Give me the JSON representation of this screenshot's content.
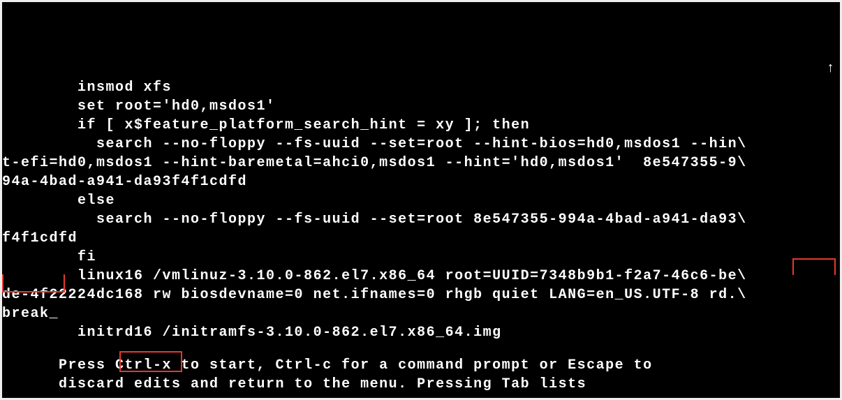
{
  "grub": {
    "lines": [
      "        insmod xfs",
      "        set root='hd0,msdos1'",
      "        if [ x$feature_platform_search_hint = xy ]; then",
      "          search --no-floppy --fs-uuid --set=root --hint-bios=hd0,msdos1 --hin\\",
      "t-efi=hd0,msdos1 --hint-baremetal=ahci0,msdos1 --hint='hd0,msdos1'  8e547355-9\\",
      "94a-4bad-a941-da93f4f1cdfd",
      "        else",
      "          search --no-floppy --fs-uuid --set=root 8e547355-994a-4bad-a941-da93\\",
      "f4f1cdfd",
      "        fi",
      "        linux16 /vmlinuz-3.10.0-862.el7.x86_64 root=UUID=7348b9b1-f2a7-46c6-be\\",
      "de-4f22224dc168 rw biosdevname=0 net.ifnames=0 rhgb quiet LANG=en_US.UTF-8 rd.\\",
      "break_",
      "        initrd16 /initramfs-3.10.0-862.el7.x86_64.img"
    ],
    "footer": [
      "      Press Ctrl-x to start, Ctrl-c for a command prompt or Escape to",
      "      discard edits and return to the menu. Pressing Tab lists"
    ],
    "highlights": {
      "rd_break_suffix": "rd.\\",
      "rd_break_wrap": "break",
      "ctrl_x": "Ctrl-x"
    },
    "scroll_indicator": "↑"
  }
}
